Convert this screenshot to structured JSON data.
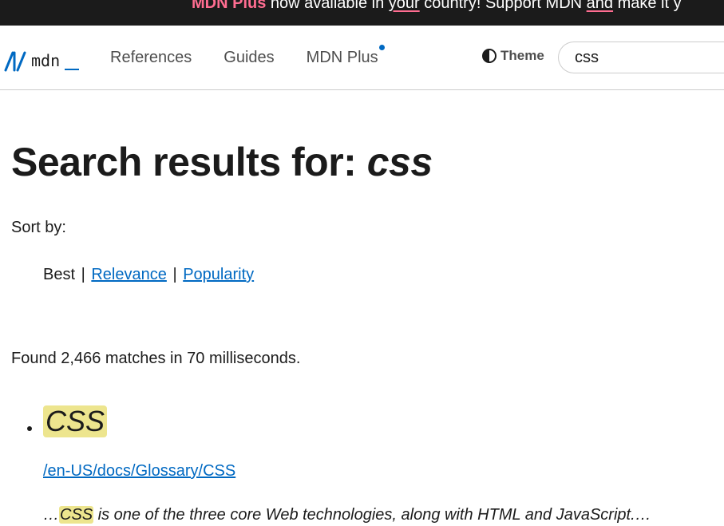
{
  "banner": {
    "brand": "MDN Plus",
    "text_1": " now available in ",
    "link_1": "your",
    "text_2": " country! Support MDN ",
    "link_2": "and",
    "text_3": " make it y"
  },
  "header": {
    "logo_text": "mdn",
    "nav": [
      {
        "label": "References"
      },
      {
        "label": "Guides"
      },
      {
        "label": "MDN Plus",
        "has_dot": true
      }
    ],
    "theme_label": "Theme",
    "search_value": "css"
  },
  "page": {
    "title_prefix": "Search results for: ",
    "title_query": "css",
    "sort_label": "Sort by:",
    "sort_current": "Best",
    "sort_sep": "|",
    "sort_relevance": "Relevance",
    "sort_popularity": "Popularity",
    "found_text": "Found 2,466 matches in 70 milliseconds."
  },
  "results": [
    {
      "title": "CSS",
      "url": "/en-US/docs/Glossary/CSS",
      "summary_prefix": "…",
      "summary_highlight": "CSS",
      "summary_rest": " is one of the three core Web technologies, along with HTML and JavaScript.…"
    }
  ],
  "colors": {
    "banner_bg": "#1b1b1b",
    "brand_pink": "#ff6d91",
    "link_blue": "#0069c2",
    "highlight": "#ede58e"
  },
  "icons": {
    "logo": "mdn-logo-icon",
    "theme": "half-circle-theme-icon",
    "bullet": "bullet-dot-icon"
  }
}
